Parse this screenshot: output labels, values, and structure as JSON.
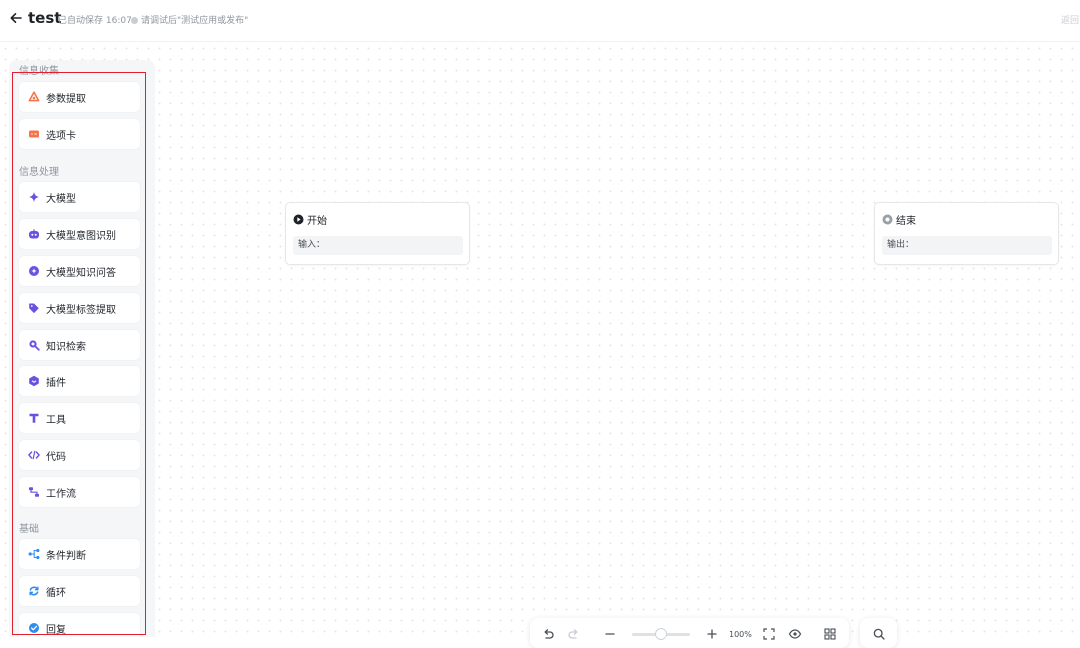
{
  "header": {
    "title": "test",
    "autosave": "已自动保存 16:07",
    "hint": "请调试后\"测试应用或发布\"",
    "return_label": "返回"
  },
  "panel": {
    "groups": [
      {
        "label": "信息收集"
      },
      {
        "label": "信息处理"
      },
      {
        "label": "基础"
      }
    ],
    "items": [
      {
        "label": "参数提取",
        "icon": "param-extract-icon",
        "color": "#f5734a"
      },
      {
        "label": "选项卡",
        "icon": "option-card-icon",
        "color": "#f5734a"
      },
      {
        "label": "大模型",
        "icon": "sparkle-icon",
        "color": "#6a52e0"
      },
      {
        "label": "大模型意图识别",
        "icon": "robot-icon",
        "color": "#6a52e0"
      },
      {
        "label": "大模型知识问答",
        "icon": "knowledge-qa-icon",
        "color": "#6a52e0"
      },
      {
        "label": "大模型标签提取",
        "icon": "tag-icon",
        "color": "#6a52e0"
      },
      {
        "label": "知识检索",
        "icon": "search-icon",
        "color": "#6a52e0"
      },
      {
        "label": "插件",
        "icon": "plugin-icon",
        "color": "#6a52e0"
      },
      {
        "label": "工具",
        "icon": "tool-icon",
        "color": "#6a52e0"
      },
      {
        "label": "代码",
        "icon": "code-icon",
        "color": "#6a52e0"
      },
      {
        "label": "工作流",
        "icon": "workflow-icon",
        "color": "#6a52e0"
      },
      {
        "label": "条件判断",
        "icon": "branch-icon",
        "color": "#2f8cf0"
      },
      {
        "label": "循环",
        "icon": "loop-icon",
        "color": "#2f8cf0"
      },
      {
        "label": "回复",
        "icon": "reply-icon",
        "color": "#2f8cf0"
      }
    ]
  },
  "nodes": {
    "start": {
      "title": "开始",
      "field_label": "输入："
    },
    "end": {
      "title": "结束",
      "field_label": "输出："
    }
  },
  "toolbar": {
    "zoom": "100%",
    "zoom_level": 0.5
  },
  "colors": {
    "highlight": "#e0202e",
    "accent": "#6a52e0"
  }
}
